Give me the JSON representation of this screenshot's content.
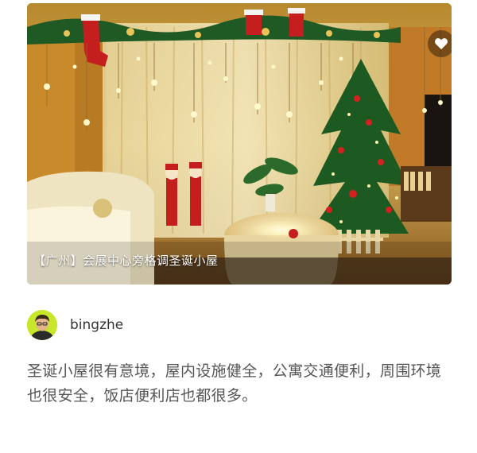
{
  "photo": {
    "caption": "【广州】会展中心旁格调圣诞小屋",
    "favorite_icon": "heart-icon"
  },
  "author": {
    "name": "bingzhe",
    "avatar_icon": "user-avatar"
  },
  "review": {
    "text": "圣诞小屋很有意境，屋内设施健全，公寓交通便利，周围环境也很安全，饭店便利店也都很多。"
  },
  "colors": {
    "caption_text": "#ffffff",
    "body_text": "#555555",
    "author_text": "#333333",
    "avatar_bg": "#c8e62a"
  }
}
